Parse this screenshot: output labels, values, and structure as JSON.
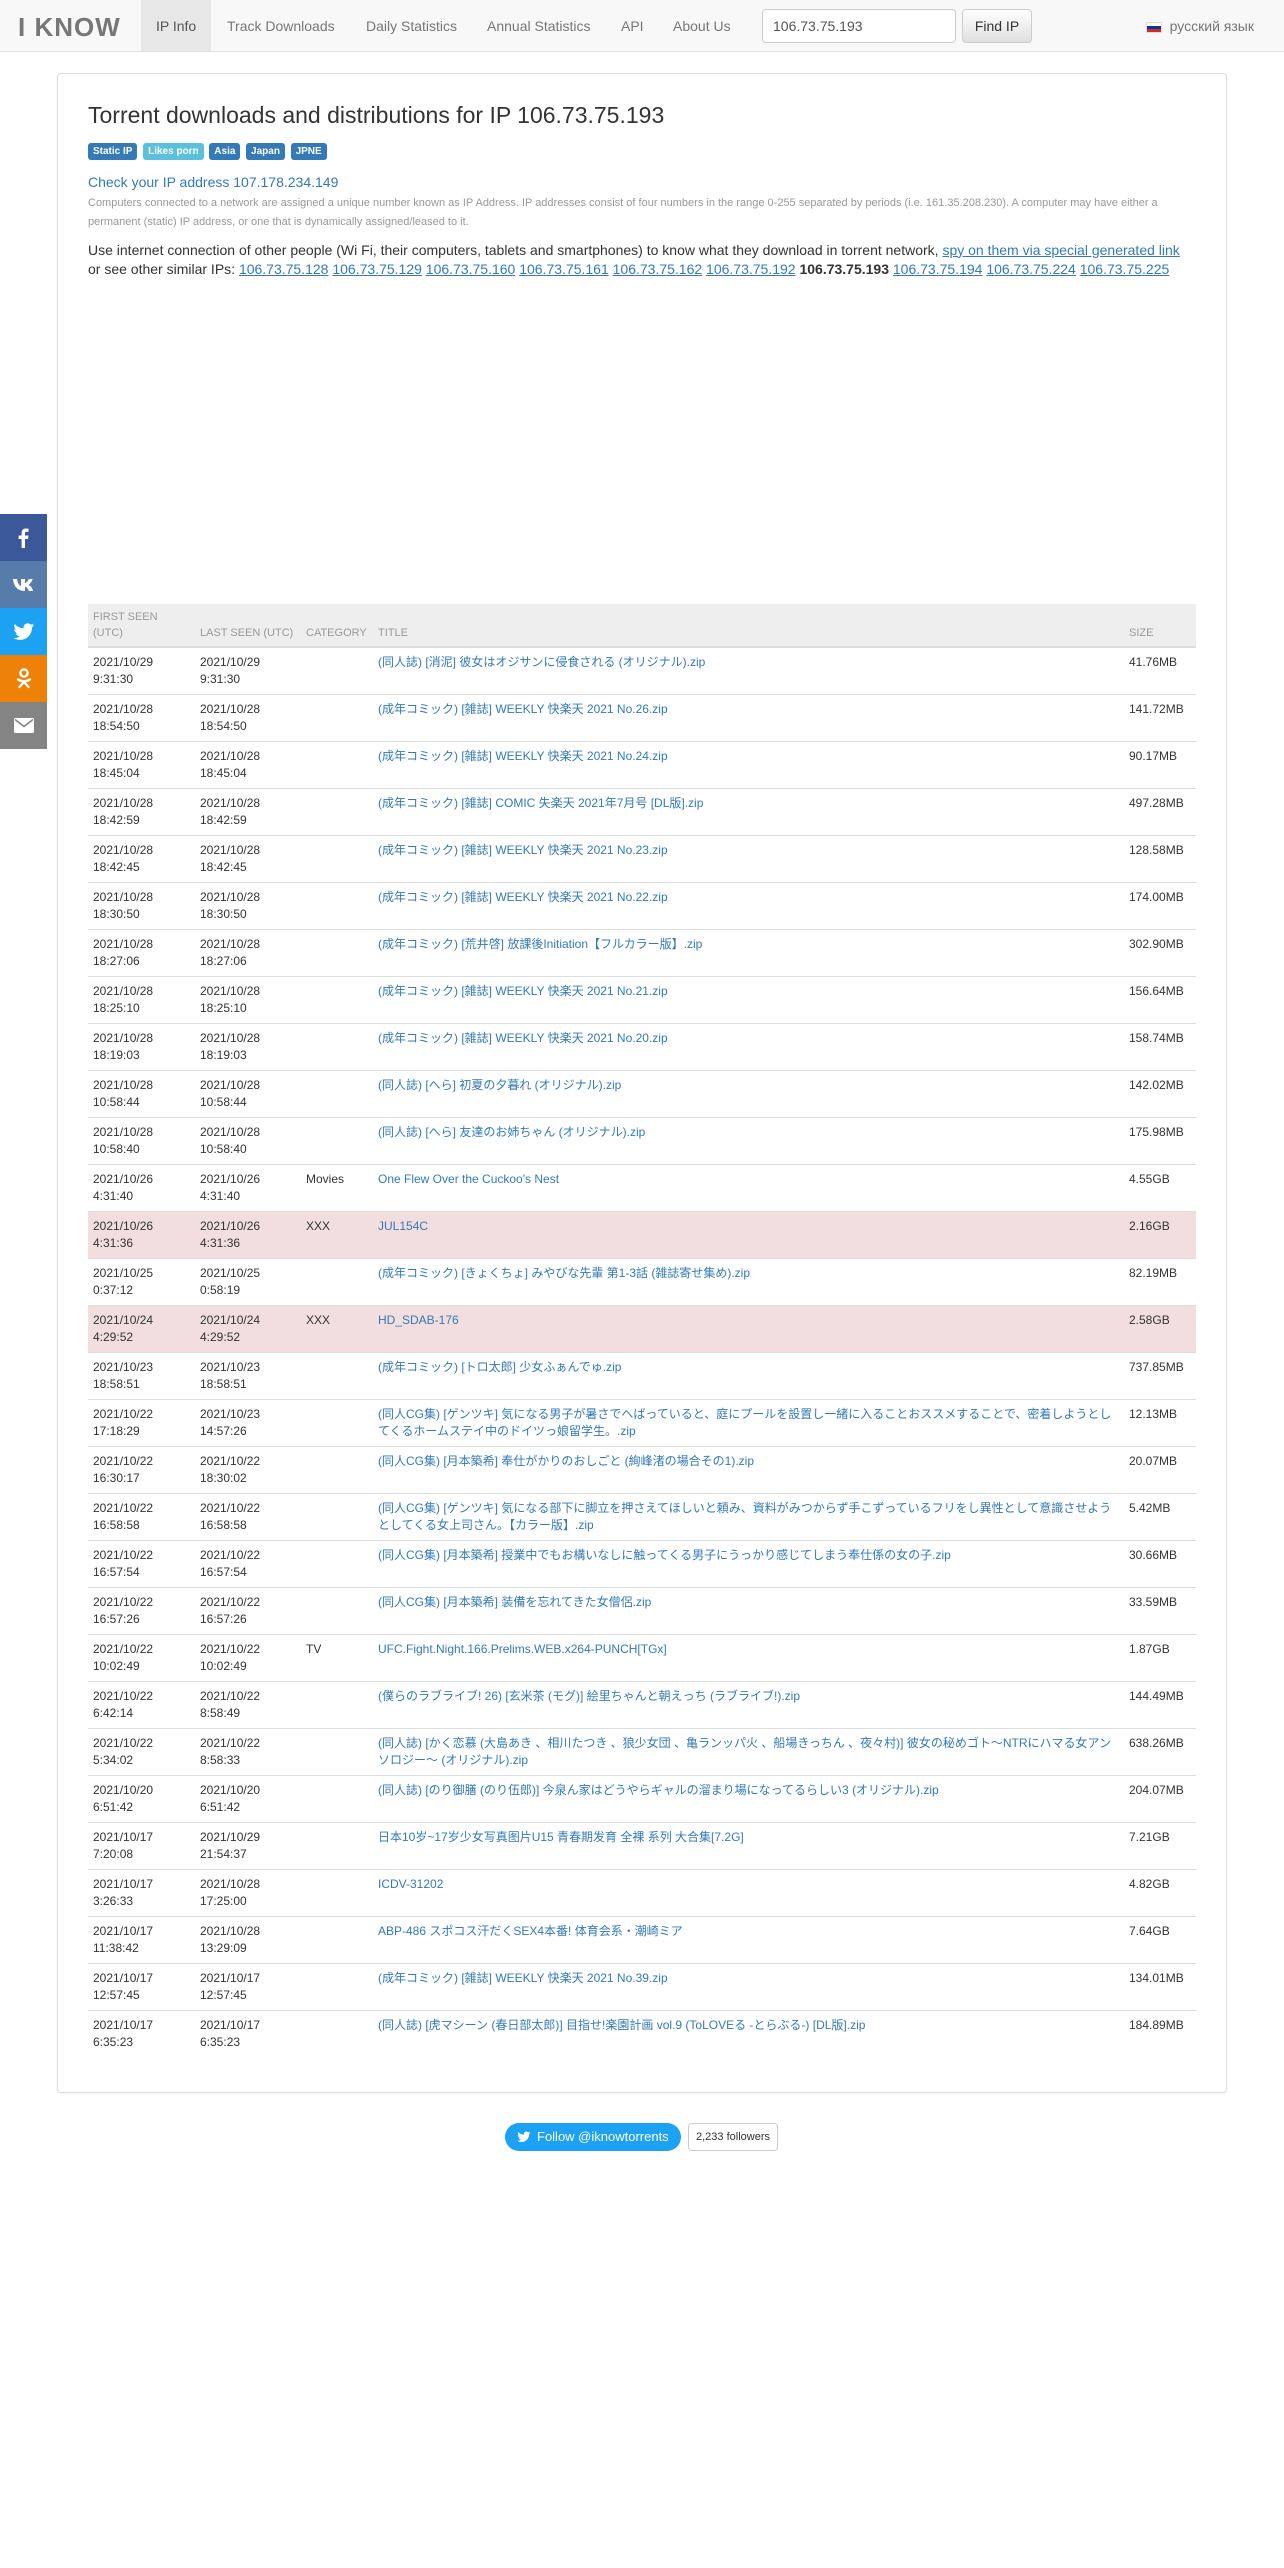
{
  "nav": {
    "brand": "I KNOW",
    "items": [
      "IP Info",
      "Track Downloads",
      "Daily Statistics",
      "Annual Statistics",
      "API",
      "About Us"
    ],
    "search_value": "106.73.75.193",
    "find_label": "Find IP",
    "language": "русский язык"
  },
  "page": {
    "title": "Torrent downloads and distributions for IP 106.73.75.193",
    "labels": [
      "Static IP",
      "Likes porn",
      "Asia",
      "Japan",
      "JPNE"
    ],
    "check_link": "Check your IP address 107.178.234.149",
    "info_text": "Computers connected to a network are assigned a unique number known as IP Address. IP addresses consist of four numbers in the range 0-255 separated by periods (i.e. 161.35.208.230). A computer may have either a permanent (static) IP address, or one that is dynamically assigned/leased to it.",
    "use_text_1": "Use internet connection of other people (Wi Fi, their computers, tablets and smartphones) to know what they download in torrent network, ",
    "use_link": "spy on them via special generated link",
    "use_text_2": " or see other similar IPs: ",
    "similar_ips": [
      "106.73.75.128",
      "106.73.75.129",
      "106.73.75.160",
      "106.73.75.161",
      "106.73.75.162",
      "106.73.75.192",
      "106.73.75.193",
      "106.73.75.194",
      "106.73.75.224",
      "106.73.75.225"
    ],
    "current_ip": "106.73.75.193"
  },
  "table": {
    "headers": [
      "FIRST SEEN (UTC)",
      "LAST SEEN (UTC)",
      "CATEGORY",
      "TITLE",
      "SIZE"
    ],
    "rows": [
      {
        "first": [
          "2021/10/29",
          "9:31:30"
        ],
        "last": [
          "2021/10/29",
          "9:31:30"
        ],
        "category": "",
        "title": "(同人誌) [消泥] 彼女はオジサンに侵食される (オリジナル).zip",
        "size": "41.76MB",
        "danger": false
      },
      {
        "first": [
          "2021/10/28",
          "18:54:50"
        ],
        "last": [
          "2021/10/28",
          "18:54:50"
        ],
        "category": "",
        "title": "(成年コミック) [雑誌] WEEKLY 快楽天 2021 No.26.zip",
        "size": "141.72MB",
        "danger": false
      },
      {
        "first": [
          "2021/10/28",
          "18:45:04"
        ],
        "last": [
          "2021/10/28",
          "18:45:04"
        ],
        "category": "",
        "title": "(成年コミック) [雑誌] WEEKLY 快楽天 2021 No.24.zip",
        "size": "90.17MB",
        "danger": false
      },
      {
        "first": [
          "2021/10/28",
          "18:42:59"
        ],
        "last": [
          "2021/10/28",
          "18:42:59"
        ],
        "category": "",
        "title": "(成年コミック) [雑誌] COMIC 失楽天 2021年7月号 [DL版].zip",
        "size": "497.28MB",
        "danger": false
      },
      {
        "first": [
          "2021/10/28",
          "18:42:45"
        ],
        "last": [
          "2021/10/28",
          "18:42:45"
        ],
        "category": "",
        "title": "(成年コミック) [雑誌] WEEKLY 快楽天 2021 No.23.zip",
        "size": "128.58MB",
        "danger": false
      },
      {
        "first": [
          "2021/10/28",
          "18:30:50"
        ],
        "last": [
          "2021/10/28",
          "18:30:50"
        ],
        "category": "",
        "title": "(成年コミック) [雑誌] WEEKLY 快楽天 2021 No.22.zip",
        "size": "174.00MB",
        "danger": false
      },
      {
        "first": [
          "2021/10/28",
          "18:27:06"
        ],
        "last": [
          "2021/10/28",
          "18:27:06"
        ],
        "category": "",
        "title": "(成年コミック) [荒井啓] 放課後Initiation【フルカラー版】.zip",
        "size": "302.90MB",
        "danger": false
      },
      {
        "first": [
          "2021/10/28",
          "18:25:10"
        ],
        "last": [
          "2021/10/28",
          "18:25:10"
        ],
        "category": "",
        "title": "(成年コミック) [雑誌] WEEKLY 快楽天 2021 No.21.zip",
        "size": "156.64MB",
        "danger": false
      },
      {
        "first": [
          "2021/10/28",
          "18:19:03"
        ],
        "last": [
          "2021/10/28",
          "18:19:03"
        ],
        "category": "",
        "title": "(成年コミック) [雑誌] WEEKLY 快楽天 2021 No.20.zip",
        "size": "158.74MB",
        "danger": false
      },
      {
        "first": [
          "2021/10/28",
          "10:58:44"
        ],
        "last": [
          "2021/10/28",
          "10:58:44"
        ],
        "category": "",
        "title": "(同人誌) [へら] 初夏の夕暮れ (オリジナル).zip",
        "size": "142.02MB",
        "danger": false
      },
      {
        "first": [
          "2021/10/28",
          "10:58:40"
        ],
        "last": [
          "2021/10/28",
          "10:58:40"
        ],
        "category": "",
        "title": "(同人誌) [へら] 友達のお姉ちゃん (オリジナル).zip",
        "size": "175.98MB",
        "danger": false
      },
      {
        "first": [
          "2021/10/26",
          "4:31:40"
        ],
        "last": [
          "2021/10/26",
          "4:31:40"
        ],
        "category": "Movies",
        "title": "One Flew Over the Cuckoo's Nest",
        "size": "4.55GB",
        "danger": false
      },
      {
        "first": [
          "2021/10/26",
          "4:31:36"
        ],
        "last": [
          "2021/10/26",
          "4:31:36"
        ],
        "category": "XXX",
        "title": "JUL154C",
        "size": "2.16GB",
        "danger": true
      },
      {
        "first": [
          "2021/10/25",
          "0:37:12"
        ],
        "last": [
          "2021/10/25",
          "0:58:19"
        ],
        "category": "",
        "title": "(成年コミック) [きょくちょ] みやびな先輩 第1-3話 (雑誌寄せ集め).zip",
        "size": "82.19MB",
        "danger": false
      },
      {
        "first": [
          "2021/10/24",
          "4:29:52"
        ],
        "last": [
          "2021/10/24",
          "4:29:52"
        ],
        "category": "XXX",
        "title": "HD_SDAB-176",
        "size": "2.58GB",
        "danger": true
      },
      {
        "first": [
          "2021/10/23",
          "18:58:51"
        ],
        "last": [
          "2021/10/23",
          "18:58:51"
        ],
        "category": "",
        "title": "(成年コミック) [トロ太郎] 少女ふぁんでゅ.zip",
        "size": "737.85MB",
        "danger": false
      },
      {
        "first": [
          "2021/10/22",
          "17:18:29"
        ],
        "last": [
          "2021/10/23",
          "14:57:26"
        ],
        "category": "",
        "title": "(同人CG集) [ゲンツキ] 気になる男子が暑さでへばっていると、庭にプールを設置し一緒に入ることおススメすることで、密着しようとしてくるホームステイ中のドイツっ娘留学生。.zip",
        "size": "12.13MB",
        "danger": false
      },
      {
        "first": [
          "2021/10/22",
          "16:30:17"
        ],
        "last": [
          "2021/10/22",
          "18:30:02"
        ],
        "category": "",
        "title": "(同人CG集) [月本築希] 奉仕がかりのおしごと (絢峰渚の場合その1).zip",
        "size": "20.07MB",
        "danger": false
      },
      {
        "first": [
          "2021/10/22",
          "16:58:58"
        ],
        "last": [
          "2021/10/22",
          "16:58:58"
        ],
        "category": "",
        "title": "(同人CG集) [ゲンツキ] 気になる部下に脚立を押さえてほしいと頼み、資料がみつからず手こずっているフリをし異性として意識させようとしてくる女上司さん。【カラー版】.zip",
        "size": "5.42MB",
        "danger": false
      },
      {
        "first": [
          "2021/10/22",
          "16:57:54"
        ],
        "last": [
          "2021/10/22",
          "16:57:54"
        ],
        "category": "",
        "title": "(同人CG集) [月本築希] 授業中でもお構いなしに触ってくる男子にうっかり感じてしまう奉仕係の女の子.zip",
        "size": "30.66MB",
        "danger": false
      },
      {
        "first": [
          "2021/10/22",
          "16:57:26"
        ],
        "last": [
          "2021/10/22",
          "16:57:26"
        ],
        "category": "",
        "title": "(同人CG集) [月本築希] 装備を忘れてきた女僧侶.zip",
        "size": "33.59MB",
        "danger": false
      },
      {
        "first": [
          "2021/10/22",
          "10:02:49"
        ],
        "last": [
          "2021/10/22",
          "10:02:49"
        ],
        "category": "TV",
        "title": "UFC.Fight.Night.166.Prelims.WEB.x264-PUNCH[TGx]",
        "size": "1.87GB",
        "danger": false
      },
      {
        "first": [
          "2021/10/22",
          "6:42:14"
        ],
        "last": [
          "2021/10/22",
          "8:58:49"
        ],
        "category": "",
        "title": "(僕らのラブライブ! 26) [玄米茶 (モグ)] 絵里ちゃんと朝えっち (ラブライブ!).zip",
        "size": "144.49MB",
        "danger": false
      },
      {
        "first": [
          "2021/10/22",
          "5:34:02"
        ],
        "last": [
          "2021/10/22",
          "8:58:33"
        ],
        "category": "",
        "title": "(同人誌) [かく恋慕 (大島あき 、相川たつき 、狼少女団 、亀ランッパ火 、船場きっちん 、夜々村)] 彼女の秘めゴト～NTRにハマる女アンソロジー～ (オリジナル).zip",
        "size": "638.26MB",
        "danger": false
      },
      {
        "first": [
          "2021/10/20",
          "6:51:42"
        ],
        "last": [
          "2021/10/20",
          "6:51:42"
        ],
        "category": "",
        "title": "(同人誌) [のり御膳 (のり伍郎)] 今泉ん家はどうやらギャルの溜まり場になってるらしい3 (オリジナル).zip",
        "size": "204.07MB",
        "danger": false
      },
      {
        "first": [
          "2021/10/17",
          "7:20:08"
        ],
        "last": [
          "2021/10/29",
          "21:54:37"
        ],
        "category": "",
        "title": "日本10岁~17岁少女写真图片U15 青春期发育 全裸 系列 大合集[7.2G]",
        "size": "7.21GB",
        "danger": false
      },
      {
        "first": [
          "2021/10/17",
          "3:26:33"
        ],
        "last": [
          "2021/10/28",
          "17:25:00"
        ],
        "category": "",
        "title": "ICDV-31202",
        "size": "4.82GB",
        "danger": false
      },
      {
        "first": [
          "2021/10/17",
          "11:38:42"
        ],
        "last": [
          "2021/10/28",
          "13:29:09"
        ],
        "category": "",
        "title": "ABP-486 スポコス汗だくSEX4本番! 体育会系・潮崎ミア",
        "size": "7.64GB",
        "danger": false
      },
      {
        "first": [
          "2021/10/17",
          "12:57:45"
        ],
        "last": [
          "2021/10/17",
          "12:57:45"
        ],
        "category": "",
        "title": "(成年コミック) [雑誌] WEEKLY 快楽天 2021 No.39.zip",
        "size": "134.01MB",
        "danger": false
      },
      {
        "first": [
          "2021/10/17",
          "6:35:23"
        ],
        "last": [
          "2021/10/17",
          "6:35:23"
        ],
        "category": "",
        "title": "(同人誌) [虎マシーン (春日部太郎)] 目指せ!楽園計画 vol.9 (ToLOVEる -とらぶる-) [DL版].zip",
        "size": "184.89MB",
        "danger": false
      }
    ]
  },
  "social": {
    "icons": [
      "facebook-icon",
      "vk-icon",
      "twitter-icon",
      "odnoklassniki-icon",
      "email-icon"
    ]
  },
  "twitter": {
    "follow_label": "Follow @iknowtorrents",
    "followers": "2,233 followers"
  }
}
